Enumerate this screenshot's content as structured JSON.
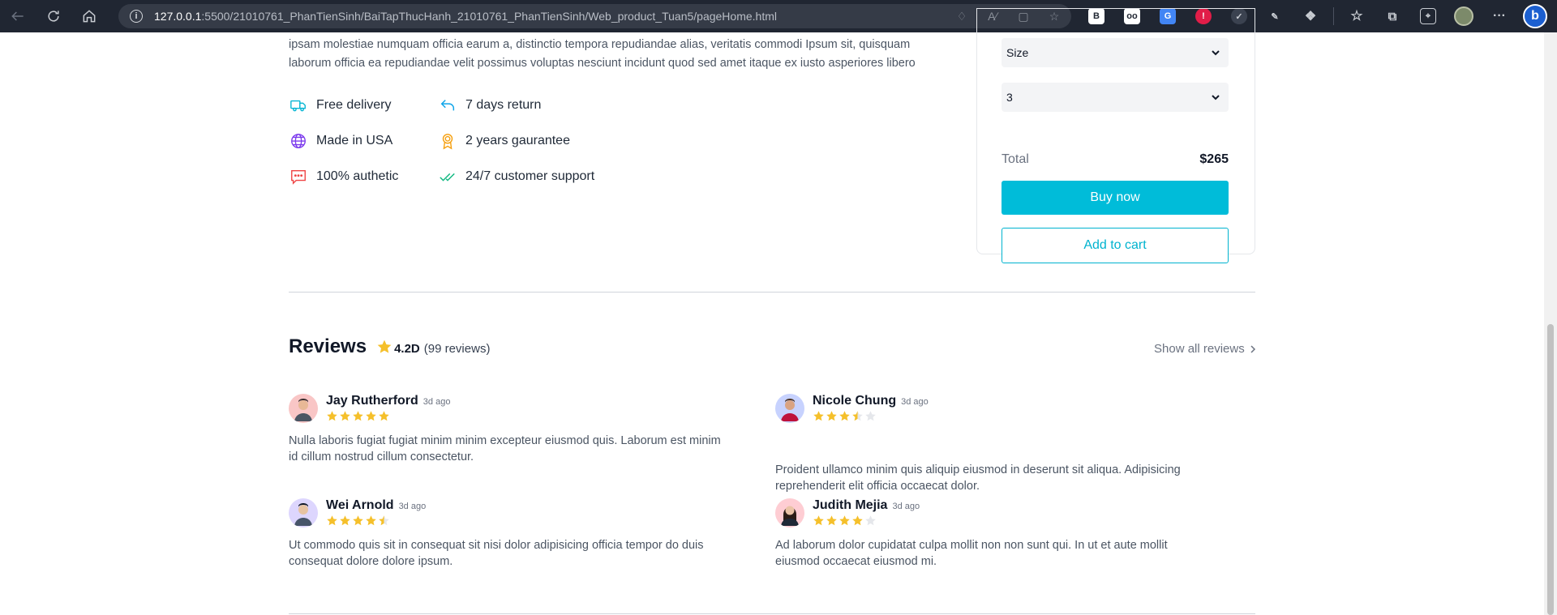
{
  "browser": {
    "url_host": "127.0.0.1",
    "url_rest": ":5500/21010761_PhanTienSinh/BaiTapThucHanh_21010761_PhanTienSinh/Web_product_Tuan5/pageHome.html"
  },
  "product": {
    "description": "ipsam molestiae numquam officia earum a, distinctio tempora repudiandae alias, veritatis commodi Ipsum sit, quisquam laborum officia ea repudiandae velit possimus voluptas nesciunt incidunt quod sed amet itaque ex iusto asperiores libero",
    "features": [
      {
        "label": "Free delivery",
        "icon": "truck-icon",
        "color": "#06b6d4"
      },
      {
        "label": "7 days return",
        "icon": "return-arrow-icon",
        "color": "#0ea5e9"
      },
      {
        "label": "Made in USA",
        "icon": "globe-icon",
        "color": "#7c3aed"
      },
      {
        "label": "2 years gaurantee",
        "icon": "award-icon",
        "color": "#f59e0b"
      },
      {
        "label": "100% authetic",
        "icon": "chat-icon",
        "color": "#ef4444"
      },
      {
        "label": "24/7 customer support",
        "icon": "double-check-icon",
        "color": "#10b981"
      }
    ]
  },
  "purchase": {
    "size_select": "Size",
    "quantity_select": "3",
    "total_label": "Total",
    "total_value": "$265",
    "buy_label": "Buy now",
    "cart_label": "Add to cart",
    "accent_color": "#00bcd9"
  },
  "reviews": {
    "title": "Reviews",
    "score": "4.2D",
    "count": "(99 reviews)",
    "show_all": "Show all reviews",
    "items": [
      {
        "name": "Jay Rutherford",
        "time": "3d ago",
        "rating": 5,
        "text": "Nulla laboris fugiat fugiat minim minim excepteur eiusmod quis. Laborum est minim id cillum nostrud cillum consectetur.",
        "avatar_bg": "#f9c6c6"
      },
      {
        "name": "Nicole Chung",
        "time": "3d ago",
        "rating": 3.5,
        "text": "Proident ullamco minim quis aliquip eiusmod in deserunt sit aliqua. Adipisicing reprehenderit elit officia occaecat dolor.",
        "avatar_bg": "#c7d2fe"
      },
      {
        "name": "Wei Arnold",
        "time": "3d ago",
        "rating": 4.5,
        "text": "Ut commodo quis sit in consequat sit nisi dolor adipisicing officia tempor do duis consequat dolore dolore ipsum.",
        "avatar_bg": "#ddd6fe"
      },
      {
        "name": "Judith Mejia",
        "time": "3d ago",
        "rating": 4,
        "text": "Ad laborum dolor cupidatat culpa mollit non non sunt qui. In ut et aute mollit eiusmod occaecat eiusmod mi.",
        "avatar_bg": "#fecdd3"
      }
    ]
  }
}
